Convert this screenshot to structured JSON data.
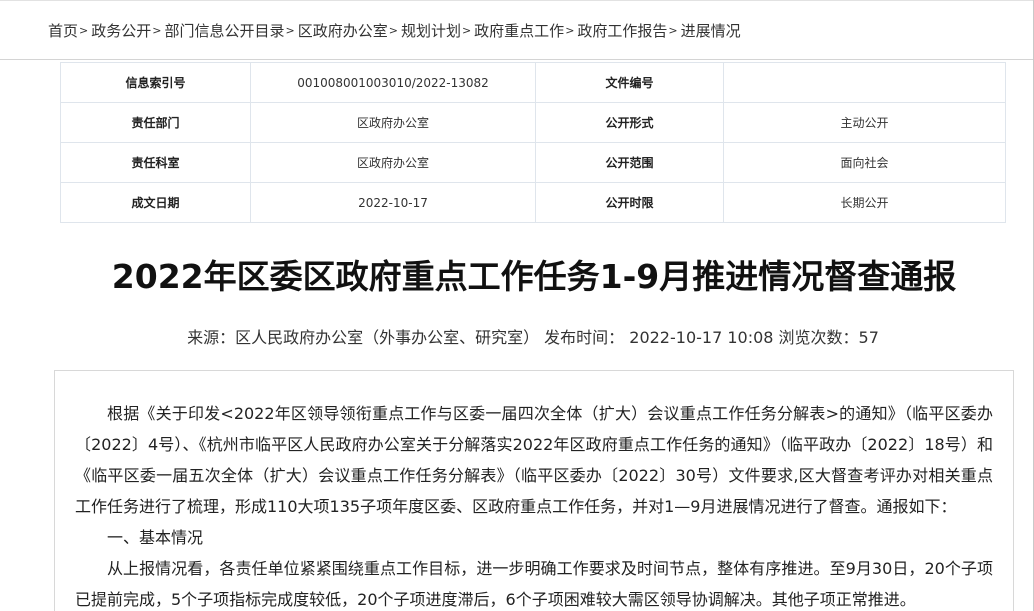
{
  "breadcrumb": [
    "首页",
    "政务公开",
    "部门信息公开目录",
    "区政府办公室",
    "规划计划",
    "政府重点工作",
    "政府工作报告",
    "进展情况"
  ],
  "breadcrumb_separator": ">",
  "info": {
    "index_no_label": "信息索引号",
    "index_no_value": "001008001003010/2022-13082",
    "doc_no_label": "文件编号",
    "doc_no_value": "",
    "dept_label": "责任部门",
    "dept_value": "区政府办公室",
    "form_label": "公开形式",
    "form_value": "主动公开",
    "section_label": "责任科室",
    "section_value": "区政府办公室",
    "scope_label": "公开范围",
    "scope_value": "面向社会",
    "date_label": "成文日期",
    "date_value": "2022-10-17",
    "period_label": "公开时限",
    "period_value": "长期公开"
  },
  "article": {
    "title": "2022年区委区政府重点工作任务1-9月推进情况督查通报",
    "meta": "来源：区人民政府办公室（外事办公室、研究室） 发布时间： 2022-10-17 10:08 浏览次数：57",
    "paragraphs": [
      "根据《关于印发<2022年区领导领衔重点工作与区委一届四次全体（扩大）会议重点工作任务分解表>的通知》（临平区委办〔2022〕4号）、《杭州市临平区人民政府办公室关于分解落实2022年区政府重点工作任务的通知》（临平政办〔2022〕18号）和《临平区委一届五次全体（扩大）会议重点工作任务分解表》（临平区委办〔2022〕30号）文件要求,区大督查考评办对相关重点工作任务进行了梳理，形成110大项135子项年度区委、区政府重点工作任务，并对1—9月进展情况进行了督查。通报如下：",
      "一、基本情况",
      "从上报情况看，各责任单位紧紧围绕重点工作目标，进一步明确工作要求及时间节点，整体有序推进。至9月30日，20个子项已提前完成，5个子项指标完成度较低，20个子项进度滞后，6个子项困难较大需区领导协调解决。其他子项正常推进。"
    ]
  }
}
